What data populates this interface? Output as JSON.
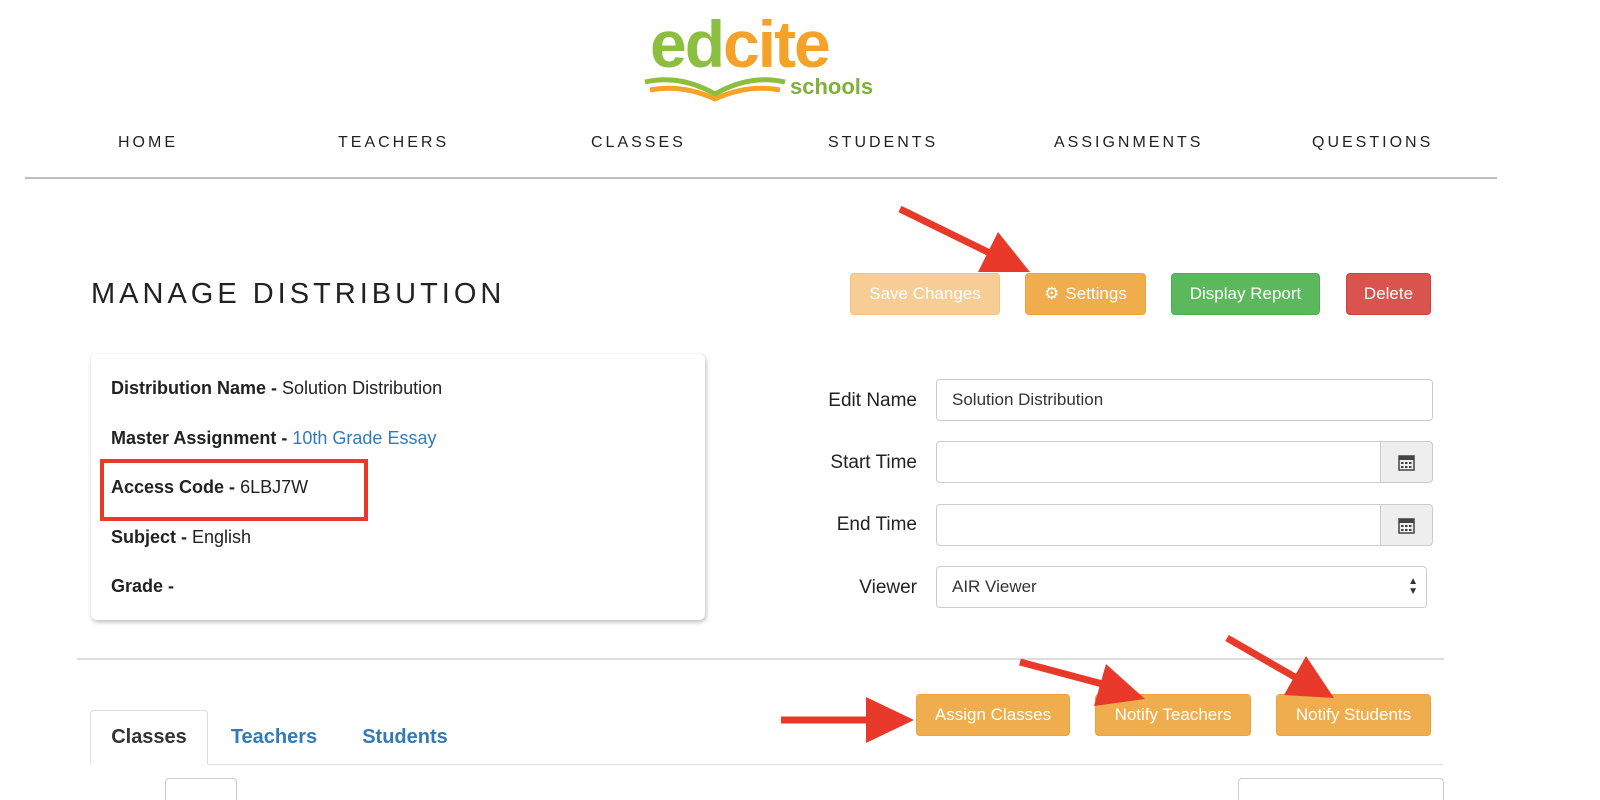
{
  "logo": {
    "part1": "ed",
    "part2": "cite",
    "sub": "schools"
  },
  "nav": [
    "HOME",
    "TEACHERS",
    "CLASSES",
    "STUDENTS",
    "ASSIGNMENTS",
    "QUESTIONS"
  ],
  "page": {
    "title": "MANAGE DISTRIBUTION"
  },
  "toolbar": {
    "save_label": "Save Changes",
    "settings_label": "Settings",
    "report_label": "Display Report",
    "delete_label": "Delete"
  },
  "info": {
    "name_label": "Distribution Name - ",
    "name_value": "Solution Distribution",
    "master_label": "Master Assignment - ",
    "master_value": "10th Grade Essay",
    "code_label": "Access Code - ",
    "code_value": "6LBJ7W",
    "subject_label": "Subject - ",
    "subject_value": "English",
    "grade_label": "Grade - "
  },
  "form": {
    "edit_name_label": "Edit Name",
    "edit_name_value": "Solution Distribution",
    "start_time_label": "Start Time",
    "end_time_label": "End Time",
    "viewer_label": "Viewer",
    "viewer_value": "AIR Viewer"
  },
  "actions": {
    "assign_classes": "Assign Classes",
    "notify_teachers": "Notify Teachers",
    "notify_students": "Notify Students"
  },
  "tabs": [
    "Classes",
    "Teachers",
    "Students"
  ],
  "colors": {
    "orange": "#f0ad4e",
    "green": "#5cb85c",
    "red": "#d9534f",
    "link": "#337ab7",
    "annotation": "#e8392a"
  }
}
